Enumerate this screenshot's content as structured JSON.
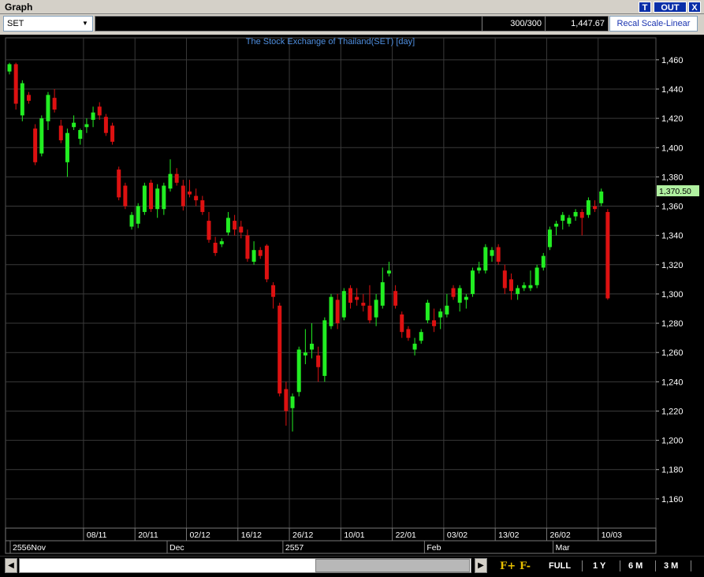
{
  "window": {
    "title": "Graph",
    "buttons": [
      "T",
      "OUT",
      "X"
    ]
  },
  "toolbar": {
    "symbol": "SET",
    "count": "300/300",
    "last_price": "1,447.67",
    "recal_label": "Recal Scale-Linear"
  },
  "bottom": {
    "f_plus": "F+",
    "f_minus": "F-",
    "ranges": [
      "FULL",
      "1 Y",
      "6 M",
      "3 M"
    ],
    "left_arrow": "◀",
    "right_arrow": "▶"
  },
  "colors": {
    "up": "#22ee22",
    "down": "#dd1111",
    "grid": "#3a3a3a",
    "title": "#4f8fe0",
    "price_tag_bg": "#b0f0a0"
  },
  "chart_data": {
    "type": "candlestick",
    "title": "The Stock Exchange of Thailand(SET) [day]",
    "ylim": [
      1140,
      1475
    ],
    "y_ticks": [
      "1,160",
      "1,180",
      "1,200",
      "1,220",
      "1,240",
      "1,260",
      "1,280",
      "1,300",
      "1,320",
      "1,340",
      "1,360",
      "1,380",
      "1,400",
      "1,420",
      "1,440",
      "1,460"
    ],
    "x_ticks": [
      {
        "label": "08/11",
        "index": 12
      },
      {
        "label": "20/11",
        "index": 20
      },
      {
        "label": "02/12",
        "index": 28
      },
      {
        "label": "16/12",
        "index": 36
      },
      {
        "label": "26/12",
        "index": 44
      },
      {
        "label": "10/01",
        "index": 52
      },
      {
        "label": "22/01",
        "index": 60
      },
      {
        "label": "03/02",
        "index": 68
      },
      {
        "label": "13/02",
        "index": 76
      },
      {
        "label": "26/02",
        "index": 84
      },
      {
        "label": "10/03",
        "index": 92
      }
    ],
    "period_labels": [
      {
        "label": "2556Nov",
        "index": 0
      },
      {
        "label": "Dec",
        "index": 25
      },
      {
        "label": "2557",
        "index": 43
      },
      {
        "label": "Feb",
        "index": 65
      },
      {
        "label": "Mar",
        "index": 85
      }
    ],
    "last_value_label": "1,370.50",
    "last_value": 1370.5,
    "candles": [
      {
        "o": 1452,
        "h": 1458,
        "l": 1450,
        "c": 1457
      },
      {
        "o": 1457,
        "h": 1458,
        "l": 1426,
        "c": 1430
      },
      {
        "o": 1422,
        "h": 1446,
        "l": 1418,
        "c": 1444
      },
      {
        "o": 1436,
        "h": 1438,
        "l": 1430,
        "c": 1432
      },
      {
        "o": 1413,
        "h": 1416,
        "l": 1388,
        "c": 1390
      },
      {
        "o": 1396,
        "h": 1422,
        "l": 1394,
        "c": 1420
      },
      {
        "o": 1418,
        "h": 1438,
        "l": 1412,
        "c": 1436
      },
      {
        "o": 1434,
        "h": 1440,
        "l": 1424,
        "c": 1426
      },
      {
        "o": 1415,
        "h": 1419,
        "l": 1403,
        "c": 1405
      },
      {
        "o": 1390,
        "h": 1413,
        "l": 1380,
        "c": 1410
      },
      {
        "o": 1414,
        "h": 1422,
        "l": 1412,
        "c": 1417
      },
      {
        "o": 1406,
        "h": 1413,
        "l": 1402,
        "c": 1412
      },
      {
        "o": 1414,
        "h": 1420,
        "l": 1410,
        "c": 1416
      },
      {
        "o": 1419,
        "h": 1428,
        "l": 1414,
        "c": 1424
      },
      {
        "o": 1428,
        "h": 1431,
        "l": 1419,
        "c": 1422
      },
      {
        "o": 1421,
        "h": 1423,
        "l": 1408,
        "c": 1410
      },
      {
        "o": 1415,
        "h": 1417,
        "l": 1402,
        "c": 1404
      },
      {
        "o": 1385,
        "h": 1387,
        "l": 1364,
        "c": 1366
      },
      {
        "o": 1374,
        "h": 1376,
        "l": 1358,
        "c": 1360
      },
      {
        "o": 1346,
        "h": 1356,
        "l": 1344,
        "c": 1354
      },
      {
        "o": 1348,
        "h": 1362,
        "l": 1345,
        "c": 1360
      },
      {
        "o": 1356,
        "h": 1376,
        "l": 1354,
        "c": 1374
      },
      {
        "o": 1376,
        "h": 1378,
        "l": 1356,
        "c": 1358
      },
      {
        "o": 1358,
        "h": 1375,
        "l": 1352,
        "c": 1372
      },
      {
        "o": 1358,
        "h": 1376,
        "l": 1354,
        "c": 1374
      },
      {
        "o": 1372,
        "h": 1392,
        "l": 1370,
        "c": 1382
      },
      {
        "o": 1382,
        "h": 1386,
        "l": 1374,
        "c": 1376
      },
      {
        "o": 1374,
        "h": 1378,
        "l": 1357,
        "c": 1360
      },
      {
        "o": 1370,
        "h": 1378,
        "l": 1366,
        "c": 1368
      },
      {
        "o": 1367,
        "h": 1372,
        "l": 1360,
        "c": 1364
      },
      {
        "o": 1364,
        "h": 1367,
        "l": 1354,
        "c": 1356
      },
      {
        "o": 1350,
        "h": 1356,
        "l": 1335,
        "c": 1337
      },
      {
        "o": 1335,
        "h": 1339,
        "l": 1326,
        "c": 1328
      },
      {
        "o": 1334,
        "h": 1338,
        "l": 1332,
        "c": 1336
      },
      {
        "o": 1342,
        "h": 1356,
        "l": 1340,
        "c": 1352
      },
      {
        "o": 1350,
        "h": 1354,
        "l": 1340,
        "c": 1344
      },
      {
        "o": 1346,
        "h": 1350,
        "l": 1338,
        "c": 1342
      },
      {
        "o": 1340,
        "h": 1344,
        "l": 1322,
        "c": 1324
      },
      {
        "o": 1322,
        "h": 1336,
        "l": 1320,
        "c": 1330
      },
      {
        "o": 1330,
        "h": 1332,
        "l": 1324,
        "c": 1326
      },
      {
        "o": 1333,
        "h": 1334,
        "l": 1308,
        "c": 1310
      },
      {
        "o": 1306,
        "h": 1308,
        "l": 1290,
        "c": 1298
      },
      {
        "o": 1292,
        "h": 1294,
        "l": 1230,
        "c": 1232
      },
      {
        "o": 1235,
        "h": 1240,
        "l": 1210,
        "c": 1220
      },
      {
        "o": 1222,
        "h": 1232,
        "l": 1206,
        "c": 1230
      },
      {
        "o": 1233,
        "h": 1264,
        "l": 1230,
        "c": 1262
      },
      {
        "o": 1258,
        "h": 1276,
        "l": 1252,
        "c": 1260
      },
      {
        "o": 1262,
        "h": 1280,
        "l": 1256,
        "c": 1266
      },
      {
        "o": 1258,
        "h": 1264,
        "l": 1240,
        "c": 1250
      },
      {
        "o": 1244,
        "h": 1284,
        "l": 1240,
        "c": 1282
      },
      {
        "o": 1278,
        "h": 1300,
        "l": 1276,
        "c": 1298
      },
      {
        "o": 1296,
        "h": 1300,
        "l": 1276,
        "c": 1280
      },
      {
        "o": 1284,
        "h": 1304,
        "l": 1282,
        "c": 1302
      },
      {
        "o": 1304,
        "h": 1306,
        "l": 1290,
        "c": 1294
      },
      {
        "o": 1298,
        "h": 1304,
        "l": 1292,
        "c": 1296
      },
      {
        "o": 1294,
        "h": 1300,
        "l": 1288,
        "c": 1292
      },
      {
        "o": 1292,
        "h": 1306,
        "l": 1280,
        "c": 1282
      },
      {
        "o": 1284,
        "h": 1300,
        "l": 1278,
        "c": 1296
      },
      {
        "o": 1292,
        "h": 1318,
        "l": 1290,
        "c": 1308
      },
      {
        "o": 1314,
        "h": 1322,
        "l": 1312,
        "c": 1316
      },
      {
        "o": 1302,
        "h": 1306,
        "l": 1290,
        "c": 1292
      },
      {
        "o": 1286,
        "h": 1288,
        "l": 1270,
        "c": 1274
      },
      {
        "o": 1276,
        "h": 1278,
        "l": 1268,
        "c": 1270
      },
      {
        "o": 1262,
        "h": 1270,
        "l": 1258,
        "c": 1266
      },
      {
        "o": 1268,
        "h": 1276,
        "l": 1266,
        "c": 1274
      },
      {
        "o": 1282,
        "h": 1296,
        "l": 1280,
        "c": 1294
      },
      {
        "o": 1282,
        "h": 1290,
        "l": 1274,
        "c": 1278
      },
      {
        "o": 1284,
        "h": 1290,
        "l": 1276,
        "c": 1288
      },
      {
        "o": 1286,
        "h": 1300,
        "l": 1284,
        "c": 1292
      },
      {
        "o": 1304,
        "h": 1306,
        "l": 1296,
        "c": 1298
      },
      {
        "o": 1294,
        "h": 1306,
        "l": 1288,
        "c": 1304
      },
      {
        "o": 1296,
        "h": 1300,
        "l": 1290,
        "c": 1298
      },
      {
        "o": 1300,
        "h": 1318,
        "l": 1298,
        "c": 1316
      },
      {
        "o": 1316,
        "h": 1322,
        "l": 1314,
        "c": 1318
      },
      {
        "o": 1316,
        "h": 1334,
        "l": 1314,
        "c": 1332
      },
      {
        "o": 1326,
        "h": 1332,
        "l": 1322,
        "c": 1330
      },
      {
        "o": 1332,
        "h": 1334,
        "l": 1320,
        "c": 1322
      },
      {
        "o": 1316,
        "h": 1320,
        "l": 1300,
        "c": 1304
      },
      {
        "o": 1310,
        "h": 1314,
        "l": 1296,
        "c": 1302
      },
      {
        "o": 1300,
        "h": 1306,
        "l": 1296,
        "c": 1304
      },
      {
        "o": 1304,
        "h": 1308,
        "l": 1302,
        "c": 1306
      },
      {
        "o": 1304,
        "h": 1316,
        "l": 1302,
        "c": 1306
      },
      {
        "o": 1306,
        "h": 1320,
        "l": 1304,
        "c": 1318
      },
      {
        "o": 1318,
        "h": 1328,
        "l": 1316,
        "c": 1326
      },
      {
        "o": 1332,
        "h": 1346,
        "l": 1330,
        "c": 1344
      },
      {
        "o": 1346,
        "h": 1350,
        "l": 1340,
        "c": 1348
      },
      {
        "o": 1350,
        "h": 1356,
        "l": 1344,
        "c": 1354
      },
      {
        "o": 1348,
        "h": 1354,
        "l": 1346,
        "c": 1352
      },
      {
        "o": 1353,
        "h": 1358,
        "l": 1350,
        "c": 1356
      },
      {
        "o": 1356,
        "h": 1358,
        "l": 1340,
        "c": 1352
      },
      {
        "o": 1354,
        "h": 1366,
        "l": 1352,
        "c": 1364
      },
      {
        "o": 1360,
        "h": 1364,
        "l": 1356,
        "c": 1358
      },
      {
        "o": 1362,
        "h": 1372,
        "l": 1360,
        "c": 1370
      },
      {
        "o": 1356,
        "h": 1358,
        "l": 1296,
        "c": 1297
      }
    ]
  }
}
